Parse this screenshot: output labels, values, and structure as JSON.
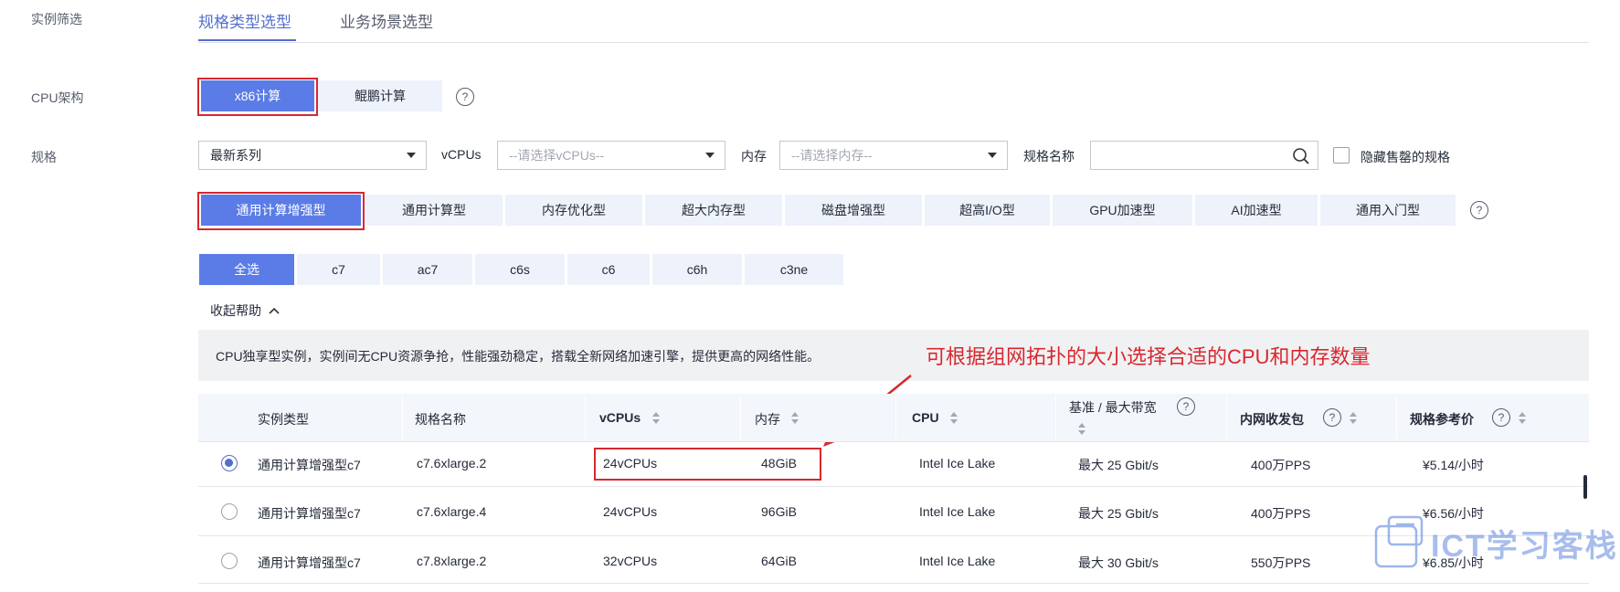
{
  "section_label": "实例筛选",
  "tabs": [
    {
      "label": "规格类型选型",
      "active": true
    },
    {
      "label": "业务场景选型",
      "active": false
    }
  ],
  "cpu_arch": {
    "label": "CPU架构",
    "options": [
      "x86计算",
      "鲲鹏计算"
    ],
    "selected": "x86计算"
  },
  "spec": {
    "label": "规格",
    "series_select": "最新系列",
    "vcpus_label": "vCPUs",
    "vcpus_placeholder": "--请选择vCPUs--",
    "memory_label": "内存",
    "memory_placeholder": "--请选择内存--",
    "name_label": "规格名称",
    "name_value": "",
    "hide_soldout_label": "隐藏售罄的规格",
    "hide_soldout_checked": false
  },
  "categories": [
    "通用计算增强型",
    "通用计算型",
    "内存优化型",
    "超大内存型",
    "磁盘增强型",
    "超高I/O型",
    "GPU加速型",
    "AI加速型",
    "通用入门型"
  ],
  "selected_category": "通用计算增强型",
  "families": [
    "全选",
    "c7",
    "ac7",
    "c6s",
    "c6",
    "c6h",
    "c3ne"
  ],
  "selected_family": "全选",
  "collapse_help_label": "收起帮助",
  "help_text": "CPU独享型实例，实例间无CPU资源争抢，性能强劲稳定，搭载全新网络加速引擎，提供更高的网络性能。",
  "annotation": "可根据组网拓扑的大小选择合适的CPU和内存数量",
  "table": {
    "headers": {
      "type": "实例类型",
      "name": "规格名称",
      "vcpus": "vCPUs",
      "memory": "内存",
      "cpu": "CPU",
      "bandwidth": "基准 / 最大带宽",
      "pps": "内网收发包",
      "price": "规格参考价"
    },
    "rows": [
      {
        "selected": true,
        "type": "通用计算增强型c7",
        "name": "c7.6xlarge.2",
        "vcpus": "24vCPUs",
        "memory": "48GiB",
        "cpu": "Intel Ice Lake",
        "bandwidth": "最大 25 Gbit/s",
        "pps": "400万PPS",
        "price": "¥5.14/小时"
      },
      {
        "selected": false,
        "type": "通用计算增强型c7",
        "name": "c7.6xlarge.4",
        "vcpus": "24vCPUs",
        "memory": "96GiB",
        "cpu": "Intel Ice Lake",
        "bandwidth": "最大 25 Gbit/s",
        "pps": "400万PPS",
        "price": "¥6.56/小时"
      },
      {
        "selected": false,
        "type": "通用计算增强型c7",
        "name": "c7.8xlarge.2",
        "vcpus": "32vCPUs",
        "memory": "64GiB",
        "cpu": "Intel Ice Lake",
        "bandwidth": "最大 30 Gbit/s",
        "pps": "550万PPS",
        "price": "¥6.85/小时"
      }
    ]
  },
  "watermark": "ICT学习客栈",
  "colors": {
    "accent": "#526ecc",
    "active_button": "#5b7ce6",
    "annotation_red": "#d9272e"
  }
}
